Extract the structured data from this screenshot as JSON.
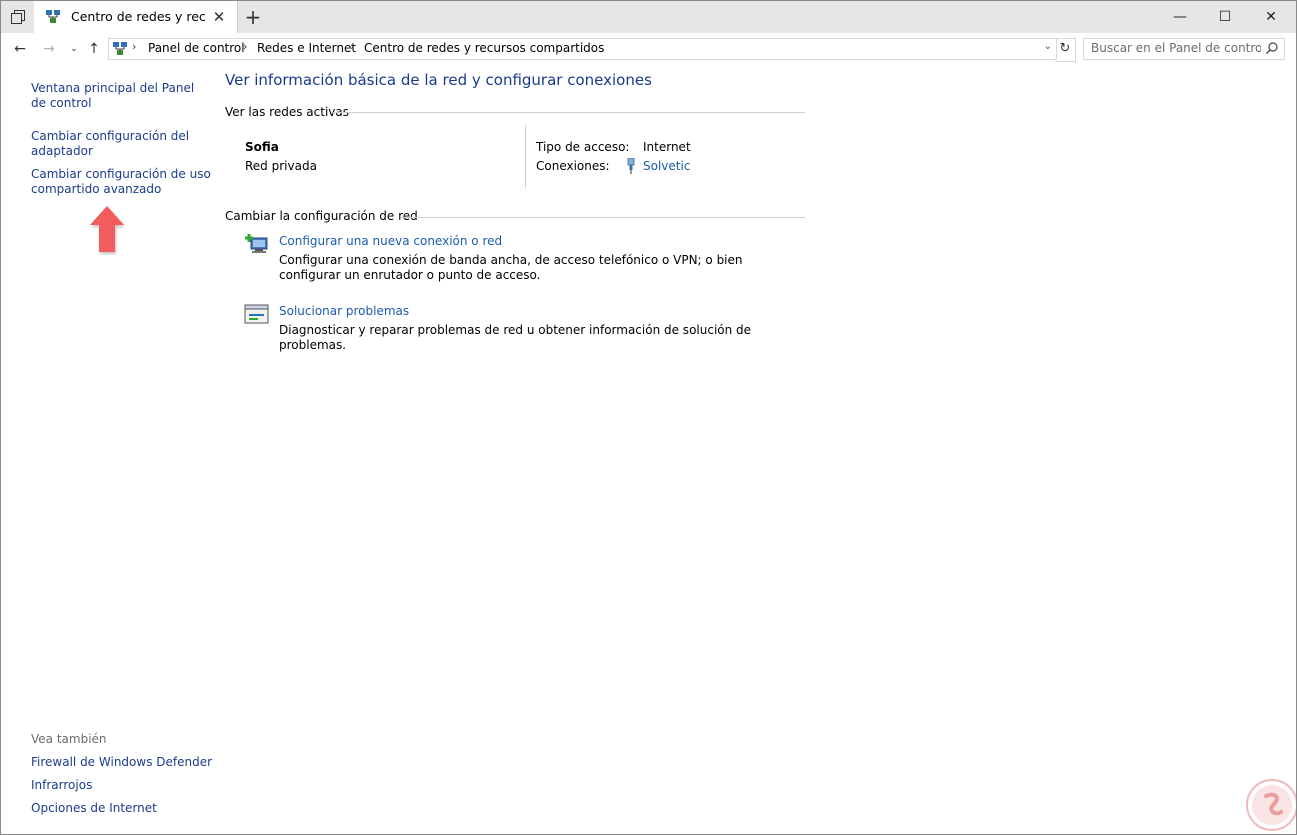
{
  "window": {
    "tab_title": "Centro de redes y recursos compartidos",
    "tab_title_visible": "Centro de redes y recu",
    "controls": {
      "minimize": "—",
      "maximize": "☐",
      "close": "✕"
    }
  },
  "address_bar": {
    "breadcrumbs": [
      "Panel de control",
      "Redes e Internet",
      "Centro de redes y recursos compartidos"
    ],
    "search_placeholder": "Buscar en el Panel de control"
  },
  "sidebar": {
    "links": [
      "Ventana principal del Panel de control",
      "Cambiar configuración del adaptador",
      "Cambiar configuración de uso compartido avanzado"
    ],
    "see_also_title": "Vea también",
    "see_also": [
      "Firewall de Windows Defender",
      "Infrarrojos",
      "Opciones de Internet"
    ]
  },
  "main": {
    "heading": "Ver información básica de la red y configurar conexiones",
    "active_networks_title": "Ver las redes activas",
    "network": {
      "name": "Sofia",
      "type": "Red privada",
      "access_type_label": "Tipo de acceso:",
      "access_type_value": "Internet",
      "connections_label": "Conexiones:",
      "connections_value": "Solvetic"
    },
    "change_settings_title": "Cambiar la configuración de red",
    "tasks": [
      {
        "link": "Configurar una nueva conexión o red",
        "desc": "Configurar una conexión de banda ancha, de acceso telefónico o VPN; o bien configurar un enrutador o punto de acceso."
      },
      {
        "link": "Solucionar problemas",
        "desc": "Diagnosticar y reparar problemas de red u obtener información de solución de problemas."
      }
    ]
  },
  "colors": {
    "link": "#1c3c8c",
    "arrow": "#f25c5c",
    "heading": "#1a3a8f"
  }
}
